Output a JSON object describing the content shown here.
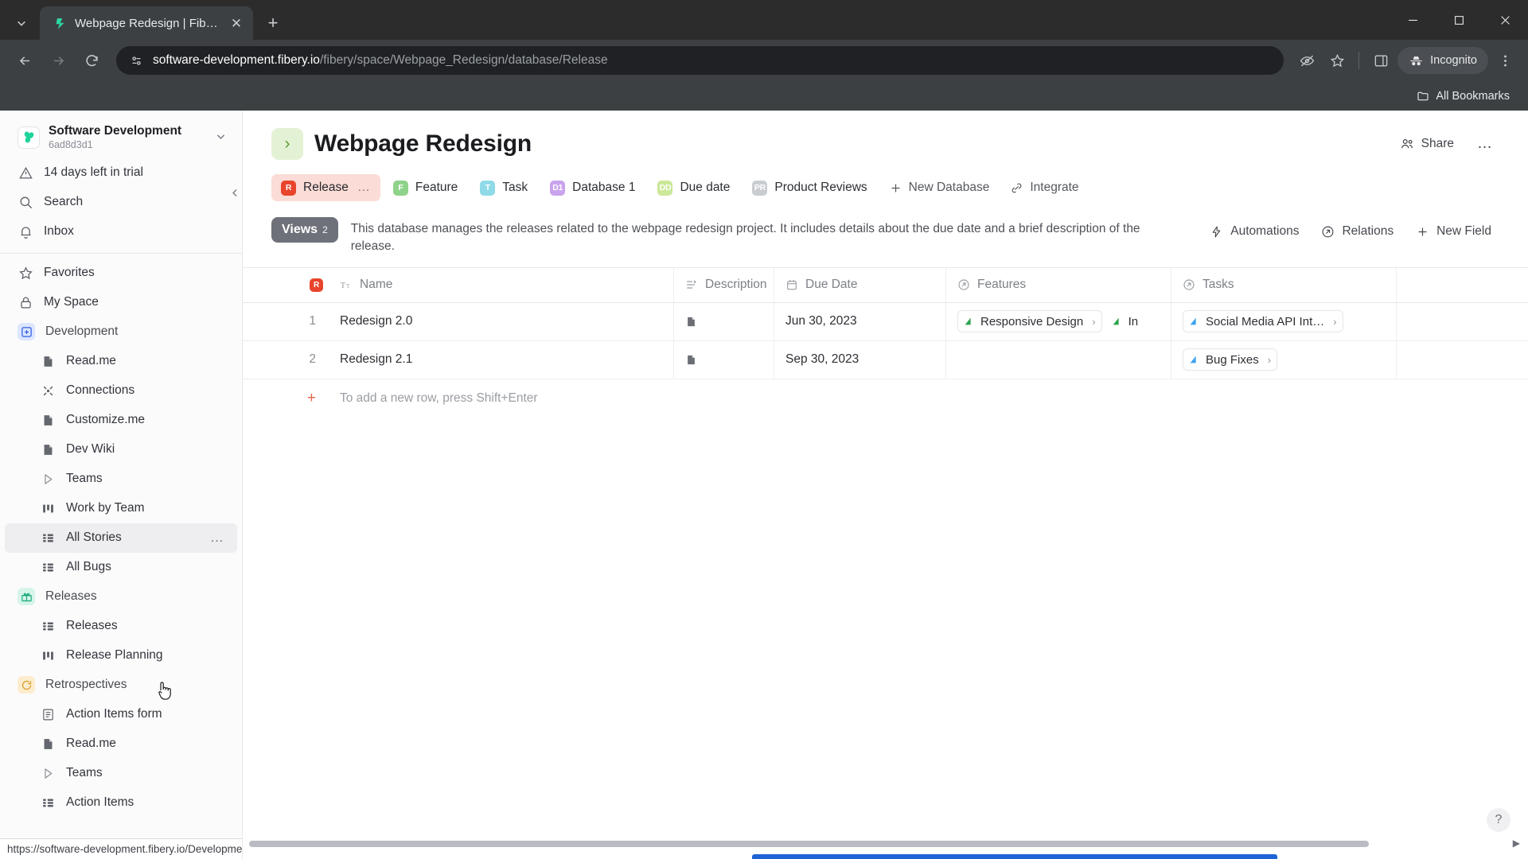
{
  "browser": {
    "tab": {
      "title": "Webpage Redesign | Fibery",
      "favicon": "fibery-logo-icon"
    },
    "new_tab_label": "+",
    "tab_search_icon": "chevron-down-icon",
    "window_controls": {
      "minimize": "—",
      "maximize": "☐",
      "close": "✕"
    },
    "url": {
      "host": "software-development.fibery.io",
      "path": "/fibery/space/Webpage_Redesign/database/Release"
    },
    "omnibox_icon": "site-settings-icon",
    "toolbar_icons": [
      "third-party-cookie-icon",
      "bookmark-star-icon",
      "side-panel-icon",
      "chrome-menu-icon"
    ],
    "incognito_label": "Incognito",
    "bookmarks": {
      "label": "All Bookmarks",
      "icon": "folder-icon"
    }
  },
  "sidebar": {
    "workspace": {
      "name": "Software Development",
      "id": "6ad8d3d1",
      "logo": "fibery-clover-icon"
    },
    "top_items": [
      {
        "label": "14 days left in trial",
        "icon": "warning-triangle-icon"
      },
      {
        "label": "Search",
        "icon": "search-icon"
      },
      {
        "label": "Inbox",
        "icon": "bell-icon"
      }
    ],
    "nav_items": [
      {
        "label": "Favorites",
        "icon": "star-icon"
      },
      {
        "label": "My Space",
        "icon": "lock-icon"
      }
    ],
    "spaces": [
      {
        "label": "Development",
        "icon": "development-space-icon",
        "icon_bg": "#dde6ff",
        "icon_color": "#2f5fe0",
        "children": [
          {
            "label": "Read.me",
            "icon": "document-icon"
          },
          {
            "label": "Connections",
            "icon": "connections-icon"
          },
          {
            "label": "Customize.me",
            "icon": "document-icon"
          },
          {
            "label": "Dev Wiki",
            "icon": "document-icon"
          },
          {
            "label": "Teams",
            "icon": "play-triangle-icon"
          },
          {
            "label": "Work by Team",
            "icon": "board-icon"
          },
          {
            "label": "All Stories",
            "icon": "grid-icon",
            "active": true,
            "more": "…"
          },
          {
            "label": "All Bugs",
            "icon": "grid-icon"
          }
        ]
      },
      {
        "label": "Releases",
        "icon": "gift-icon",
        "icon_bg": "#d6f5e8",
        "icon_color": "#17a97a",
        "children": [
          {
            "label": "Releases",
            "icon": "grid-icon"
          },
          {
            "label": "Release Planning",
            "icon": "board-icon"
          }
        ]
      },
      {
        "label": "Retrospectives",
        "icon": "retrospective-icon",
        "icon_bg": "#fdeccd",
        "icon_color": "#d79b24",
        "children": [
          {
            "label": "Action Items form",
            "icon": "form-icon"
          },
          {
            "label": "Read.me",
            "icon": "document-icon"
          },
          {
            "label": "Teams",
            "icon": "play-triangle-icon"
          },
          {
            "label": "Action Items",
            "icon": "grid-icon"
          }
        ]
      }
    ],
    "collapse_icon": "chevron-left-icon",
    "status_link": "https://software-development.fibery.io/Development/All-Stories-16"
  },
  "main": {
    "title": "Webpage Redesign",
    "title_emoji": "›",
    "share_label": "Share",
    "share_icon": "share-people-icon",
    "more_label": "…",
    "db_tabs": [
      {
        "label": "Release",
        "badge": "R",
        "color": "#e8452c",
        "active": true,
        "dots": "…"
      },
      {
        "label": "Feature",
        "badge": "F",
        "color": "#8fd38a"
      },
      {
        "label": "Task",
        "badge": "T",
        "color": "#8fd9e8"
      },
      {
        "label": "Database 1",
        "badge": "D1",
        "color": "#c9a3ee"
      },
      {
        "label": "Due date",
        "badge": "DD",
        "color": "#cbe898"
      },
      {
        "label": "Product Reviews",
        "badge": "PR",
        "color": "#c9ccd1"
      }
    ],
    "db_actions": [
      {
        "label": "New Database",
        "icon": "plus-icon"
      },
      {
        "label": "Integrate",
        "icon": "integrate-icon"
      }
    ],
    "views_badge": {
      "label": "Views",
      "count": "2"
    },
    "description": "This database manages the releases related to the webpage redesign project. It includes details about the due date and a brief description of the release.",
    "band_actions": [
      {
        "label": "Automations",
        "icon": "lightning-icon"
      },
      {
        "label": "Relations",
        "icon": "relations-icon"
      },
      {
        "label": "New Field",
        "icon": "plus-icon"
      }
    ],
    "table": {
      "columns": [
        {
          "label": "Name",
          "icon": "text-field-icon",
          "badge": "R",
          "badge_color": "#e8452c"
        },
        {
          "label": "Description",
          "icon": "rich-text-icon"
        },
        {
          "label": "Due Date",
          "icon": "calendar-icon"
        },
        {
          "label": "Features",
          "icon": "relation-arrow-icon"
        },
        {
          "label": "Tasks",
          "icon": "relation-arrow-icon"
        }
      ],
      "rows": [
        {
          "num": "1",
          "name": "Redesign 2.0",
          "description_icon": "rich-text-doc-icon",
          "due_date": "Jun 30, 2023",
          "features": [
            {
              "label": "Responsive Design",
              "flag": "#2ea44f",
              "arrow": "›"
            },
            {
              "label": "In",
              "flag": "#2ea44f",
              "arrow": ""
            }
          ],
          "tasks": [
            {
              "label": "Social Media API Int…",
              "flag": "#3aa3f0",
              "arrow": "›"
            }
          ]
        },
        {
          "num": "2",
          "name": "Redesign 2.1",
          "description_icon": "rich-text-doc-icon",
          "due_date": "Sep 30, 2023",
          "features": [],
          "tasks": [
            {
              "label": "Bug Fixes",
              "flag": "#3aa3f0",
              "arrow": "›"
            }
          ]
        }
      ],
      "add_row": {
        "plus": "+",
        "hint": "To add a new row, press Shift+Enter"
      }
    },
    "help_label": "?"
  }
}
